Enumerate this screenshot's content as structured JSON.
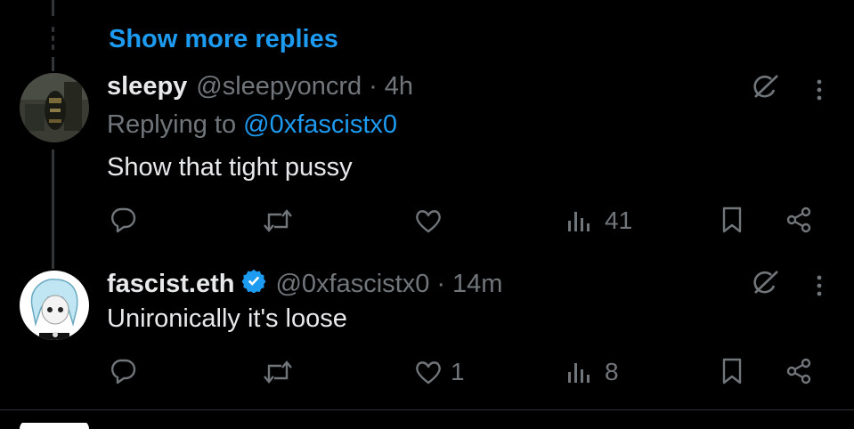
{
  "show_more": "Show more replies",
  "tweets": [
    {
      "name": "sleepy",
      "handle": "@sleepyoncrd",
      "sep": "·",
      "time": "4h",
      "replying_prefix": "Replying to",
      "replying_to": "@0xfascistx0",
      "text": "Show that tight pussy",
      "reply_count": "",
      "retweet_count": "",
      "like_count": "",
      "views": "41"
    },
    {
      "name": "fascist.eth",
      "handle": "@0xfascistx0",
      "sep": "·",
      "time": "14m",
      "text": "Unironically it's loose",
      "reply_count": "",
      "retweet_count": "",
      "like_count": "1",
      "views": "8"
    }
  ],
  "icons": {
    "grok": "grok-icon",
    "more": "more-icon",
    "reply": "reply-icon",
    "retweet": "retweet-icon",
    "like": "like-icon",
    "views": "views-icon",
    "bookmark": "bookmark-icon",
    "share": "share-icon",
    "verified": "verified-badge-icon"
  },
  "colors": {
    "background": "#000000",
    "link": "#1d9bf0",
    "muted": "#71767b",
    "text": "#e7e9ea"
  }
}
